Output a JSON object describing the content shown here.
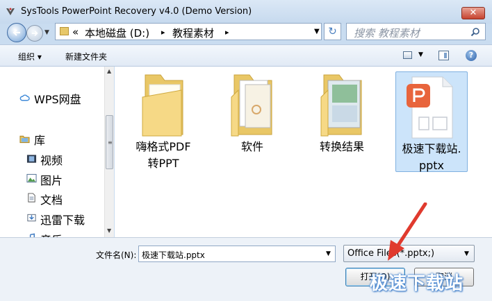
{
  "window": {
    "title": "SysTools PowerPoint Recovery v4.0 (Demo Version)",
    "close_label": "✕"
  },
  "address_bar": {
    "prefix": "«",
    "crumbs": [
      "本地磁盘 (D:)",
      "教程素材"
    ],
    "separator": "▸"
  },
  "search": {
    "placeholder": "搜索 教程素材"
  },
  "toolbar": {
    "organize_label": "组织 ▾",
    "new_folder_label": "新建文件夹",
    "help_label": "?"
  },
  "nav_pane": {
    "items": [
      {
        "label": "WPS网盘",
        "icon": "cloud-icon"
      },
      {
        "label": "库",
        "icon": "library-icon"
      },
      {
        "label": "视频",
        "icon": "video-icon"
      },
      {
        "label": "图片",
        "icon": "picture-icon"
      },
      {
        "label": "文档",
        "icon": "document-icon"
      },
      {
        "label": "迅雷下载",
        "icon": "download-icon"
      },
      {
        "label": "音乐",
        "icon": "music-icon"
      }
    ]
  },
  "files": [
    {
      "name": "嗨格式PDF转PPT",
      "line1": "嗨格式PDF",
      "line2": "转PPT",
      "type": "folder"
    },
    {
      "name": "软件",
      "line1": "软件",
      "line2": "",
      "type": "folder"
    },
    {
      "name": "转换结果",
      "line1": "转换结果",
      "line2": "",
      "type": "folder"
    },
    {
      "name": "极速下载站.pptx",
      "line1": "极速下载站.",
      "line2": "pptx",
      "type": "pptx",
      "selected": true
    }
  ],
  "bottom": {
    "filename_label": "文件名(N):",
    "filename_value": "极速下载站.pptx",
    "filter_value": "Office Files(*.pptx;)",
    "open_label": "打开(O)",
    "cancel_label": "取消"
  },
  "watermark": "极速下载站",
  "colors": {
    "accent": "#3c7fb1",
    "selection": "#cce4fa",
    "pptx_brand": "#e8643c",
    "folder": "#f2d27a",
    "arrow": "#e03a2e"
  }
}
